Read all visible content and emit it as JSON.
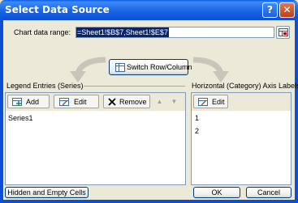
{
  "window": {
    "title": "Select Data Source",
    "help_glyph": "?",
    "close_glyph": "✕"
  },
  "range": {
    "label": "Chart data range:",
    "value": "=Sheet1!$B$7,Sheet1!$E$7"
  },
  "switch_button": {
    "label": "Switch Row/Column"
  },
  "legend": {
    "title": "Legend Entries (Series)",
    "add_label": "Add",
    "edit_label": "Edit",
    "remove_label": "Remove",
    "up_glyph": "▲",
    "down_glyph": "▼",
    "items": [
      "Series1"
    ]
  },
  "axis": {
    "title": "Horizontal (Category) Axis Labels",
    "edit_label": "Edit",
    "items": [
      "1",
      "2"
    ]
  },
  "footer": {
    "hidden_cells_label": "Hidden and Empty Cells",
    "ok_label": "OK",
    "cancel_label": "Cancel"
  },
  "colors": {
    "titlebar": "#0b4fd6",
    "selection": "#0a246a",
    "dialog_bg": "#ece9d8"
  }
}
